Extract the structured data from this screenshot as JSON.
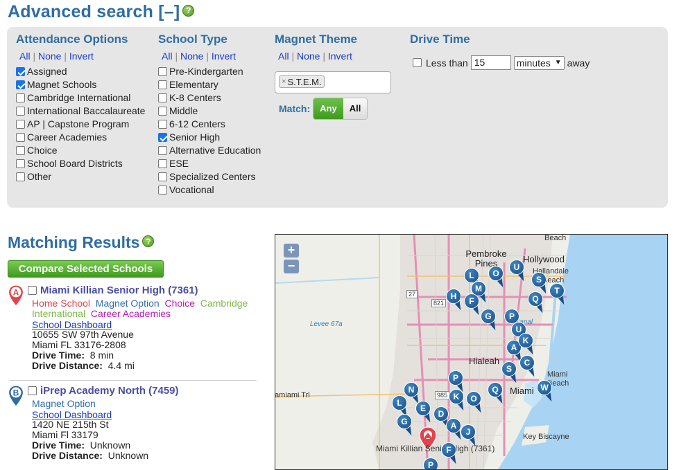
{
  "search": {
    "title": "Advanced search [–]",
    "toggle_links": {
      "all": "All",
      "none": "None",
      "invert": "Invert",
      "sep": "|"
    },
    "attendance": {
      "heading": "Attendance Options",
      "options": [
        {
          "label": "Assigned",
          "checked": true
        },
        {
          "label": "Magnet Schools",
          "checked": true
        },
        {
          "label": "Cambridge International",
          "checked": false
        },
        {
          "label": "International Baccalaureate",
          "checked": false
        },
        {
          "label": "AP | Capstone Program",
          "checked": false
        },
        {
          "label": "Career Academies",
          "checked": false
        },
        {
          "label": "Choice",
          "checked": false
        },
        {
          "label": "School Board Districts",
          "checked": false
        },
        {
          "label": "Other",
          "checked": false
        }
      ]
    },
    "school_type": {
      "heading": "School Type",
      "options": [
        {
          "label": "Pre-Kindergarten",
          "checked": false
        },
        {
          "label": "Elementary",
          "checked": false
        },
        {
          "label": "K-8 Centers",
          "checked": false
        },
        {
          "label": "Middle",
          "checked": false
        },
        {
          "label": "6-12 Centers",
          "checked": false
        },
        {
          "label": "Senior High",
          "checked": true
        },
        {
          "label": "Alternative Education",
          "checked": false
        },
        {
          "label": "ESE",
          "checked": false
        },
        {
          "label": "Specialized Centers",
          "checked": false
        },
        {
          "label": "Vocational",
          "checked": false
        }
      ]
    },
    "magnet_theme": {
      "heading": "Magnet Theme",
      "tag": "S.T.E.M.",
      "tag_remove": "×",
      "match_label": "Match:",
      "match_any": "Any",
      "match_all": "All",
      "match_selected": "Any"
    },
    "drive_time": {
      "heading": "Drive Time",
      "less_than": "Less than",
      "value": "15",
      "unit": "minutes",
      "away": "away",
      "checked": false
    }
  },
  "results": {
    "title": "Matching Results",
    "compare_button": "Compare Selected Schools",
    "items": [
      {
        "marker": "A",
        "marker_color": "#e0444e",
        "name": "Miami Killian Senior High (7361)",
        "tags": [
          "Home School",
          "Magnet Option",
          "Choice",
          "Cambridge International",
          "Career Academies"
        ],
        "dashboard": "School Dashboard",
        "address1": "10655 SW 97th Avenue",
        "address2": "Miami FL 33176-2808",
        "drive_time_label": "Drive Time:",
        "drive_time": "8 min",
        "drive_distance_label": "Drive Distance:",
        "drive_distance": "4.4 mi"
      },
      {
        "marker": "B",
        "marker_color": "#2e6da4",
        "name": "iPrep Academy North (7459)",
        "tags": [
          "Magnet Option"
        ],
        "dashboard": "School Dashboard",
        "address1": "1420 NE 215th St",
        "address2": "Miami Fl 33179",
        "drive_time_label": "Drive Time:",
        "drive_time": "Unknown",
        "drive_distance_label": "Drive Distance:",
        "drive_distance": "Unknown"
      }
    ]
  },
  "map": {
    "zoom_in": "+",
    "zoom_out": "−",
    "labels": {
      "beach": "Beach",
      "pembroke_pines": "Pembroke Pines",
      "hollywood": "Hollywood",
      "hallandale": "Hallandale",
      "hallandale_beach": "Beach",
      "levee": "Levee 67a",
      "hialeah": "Hialeah",
      "miami_beach": "Miami Beach",
      "miami": "Miami",
      "miami_trail": "amiami Trl",
      "key_biscayne": "Key Biscayne",
      "home_label": "Miami Killian Senior High (7361)",
      "route_27": "27",
      "route_821": "821",
      "route_985": "985",
      "canal": "Canal"
    },
    "markers": [
      "L",
      "O",
      "U",
      "S",
      "T",
      "M",
      "H",
      "F",
      "Q",
      "G",
      "P",
      "U",
      "A",
      "K",
      "C",
      "S",
      "W",
      "N",
      "P",
      "L",
      "E",
      "K",
      "O",
      "Q",
      "G",
      "D",
      "A",
      "J",
      "F",
      "P"
    ]
  }
}
